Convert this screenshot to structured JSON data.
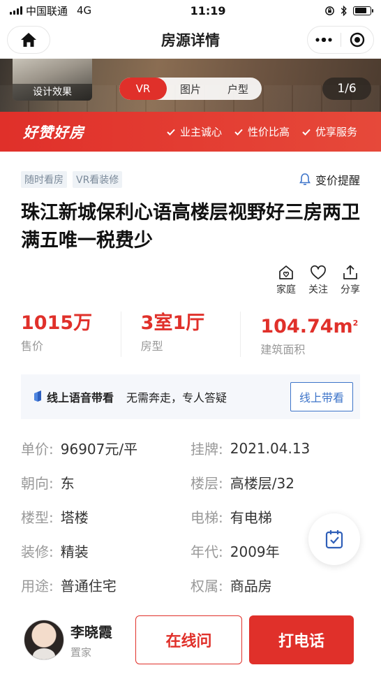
{
  "status_bar": {
    "carrier": "中国联通",
    "network": "4G",
    "time": "11:19",
    "battery_level": 0.8
  },
  "nav": {
    "title": "房源详情",
    "home_icon": "home-icon",
    "more_icon": "more-dots-icon",
    "close_icon": "target-icon"
  },
  "hero": {
    "thumb_label": "设计效果",
    "media_tabs": [
      {
        "label": "VR",
        "active": true
      },
      {
        "label": "图片",
        "active": false
      },
      {
        "label": "户型",
        "active": false
      }
    ],
    "counter": "1/6",
    "promo_brand": "好赞好房",
    "promo_items": [
      "业主诚心",
      "性价比高",
      "优享服务"
    ]
  },
  "listing": {
    "tags": [
      "随时看房",
      "VR看装修"
    ],
    "price_alert": "变价提醒",
    "title": "珠江新城保利心语高楼层视野好三房两卫满五唯一税费少",
    "actions": [
      {
        "label": "家庭",
        "icon": "home-heart-icon"
      },
      {
        "label": "关注",
        "icon": "heart-icon"
      },
      {
        "label": "分享",
        "icon": "share-icon"
      }
    ]
  },
  "stats": [
    {
      "value": "1015万",
      "label": "售价"
    },
    {
      "value": "3室1厅",
      "label": "房型"
    },
    {
      "value": "104.74m",
      "sup": "2",
      "label": "建筑面积"
    }
  ],
  "voice": {
    "title": "线上语音带看",
    "desc": "无需奔走，专人答疑",
    "button": "线上带看"
  },
  "details": [
    {
      "label": "单价:",
      "value": "96907元/平"
    },
    {
      "label": "挂牌:",
      "value": "2021.04.13"
    },
    {
      "label": "朝向:",
      "value": "东"
    },
    {
      "label": "楼层:",
      "value": "高楼层/32"
    },
    {
      "label": "楼型:",
      "value": "塔楼"
    },
    {
      "label": "电梯:",
      "value": "有电梯"
    },
    {
      "label": "装修:",
      "value": "精装"
    },
    {
      "label": "年代:",
      "value": "2009年"
    },
    {
      "label": "用途:",
      "value": "普通住宅"
    },
    {
      "label": "权属:",
      "value": "商品房"
    }
  ],
  "agent": {
    "name": "李晓霞",
    "role": "置家"
  },
  "bottom": {
    "online_button": "在线问",
    "call_button": "打电话"
  },
  "colors": {
    "accent": "#e0302a",
    "link_blue": "#3d74c9"
  }
}
